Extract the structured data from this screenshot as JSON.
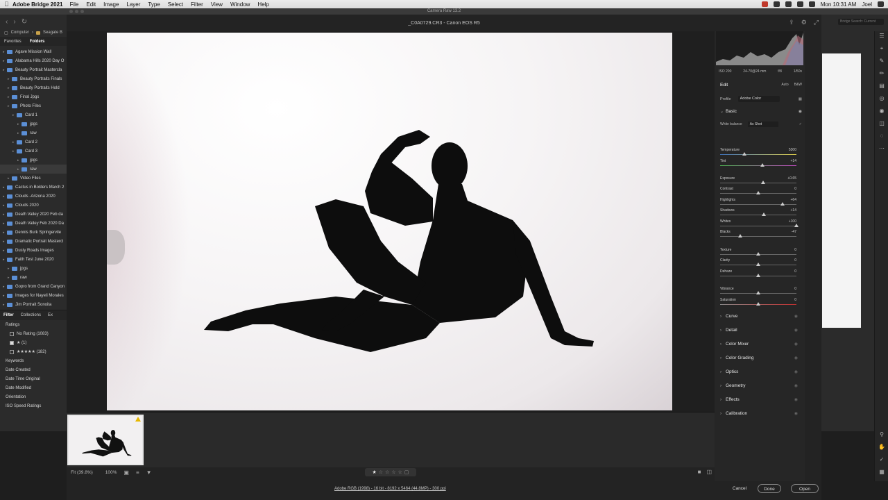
{
  "menubar": {
    "app": "Adobe Bridge 2021",
    "items": [
      "File",
      "Edit",
      "Image",
      "Layer",
      "Type",
      "Select",
      "Filter",
      "View",
      "Window",
      "Help"
    ],
    "clock": "Mon 10:31 AM",
    "user": "Joel"
  },
  "window": {
    "title": "Camera Raw 13.2"
  },
  "bridge": {
    "path": [
      "Computer",
      "Seagate B"
    ],
    "tabs": [
      "Favorites",
      "Folders"
    ],
    "folders": [
      {
        "label": "Agave Mission Wall",
        "depth": 0
      },
      {
        "label": "Alabama Hills 2020 Day O",
        "depth": 0
      },
      {
        "label": "Beauty Portrait Mastercla",
        "depth": 0
      },
      {
        "label": "Beauty Portraits Finals",
        "depth": 1
      },
      {
        "label": "Beauty Portraits Hold",
        "depth": 1
      },
      {
        "label": "Final Jpgs",
        "depth": 1
      },
      {
        "label": "Photo Files",
        "depth": 1
      },
      {
        "label": "Card 1",
        "depth": 2
      },
      {
        "label": "jpgs",
        "depth": 3
      },
      {
        "label": "raw",
        "depth": 3
      },
      {
        "label": "Card 2",
        "depth": 2
      },
      {
        "label": "Card 3",
        "depth": 2
      },
      {
        "label": "jpgs",
        "depth": 3
      },
      {
        "label": "raw",
        "depth": 3
      },
      {
        "label": "Video Files",
        "depth": 1
      },
      {
        "label": "Cactus in Bolders March 2",
        "depth": 0
      },
      {
        "label": "Clouds -Arizona 2020",
        "depth": 0
      },
      {
        "label": "Clouds 2020",
        "depth": 0
      },
      {
        "label": "Death Valley 2020 Feb da",
        "depth": 0
      },
      {
        "label": "Death Valley Feb 2020 Da",
        "depth": 0
      },
      {
        "label": "Dennis Burk Springervile",
        "depth": 0
      },
      {
        "label": "Dramatic Portrait Mastercl",
        "depth": 0
      },
      {
        "label": "Dusty Roads Images",
        "depth": 0
      },
      {
        "label": "Faith Test June 2020",
        "depth": 0
      },
      {
        "label": "jpgs",
        "depth": 1
      },
      {
        "label": "raw",
        "depth": 1
      },
      {
        "label": "Gopro from Grand Canyon",
        "depth": 0
      },
      {
        "label": "Images for Nayeli Morales",
        "depth": 0
      },
      {
        "label": "Jim Portrait Sonoita",
        "depth": 0
      }
    ],
    "filter_tabs": [
      "Filter",
      "Collections",
      "Ex"
    ],
    "filters": [
      {
        "label": "Ratings",
        "sub": false
      },
      {
        "label": "No Rating (1083)",
        "sub": true
      },
      {
        "label": "★ (1)",
        "sub": true
      },
      {
        "label": "★★★★★ (182)",
        "sub": true
      },
      {
        "label": "Keywords",
        "sub": false
      },
      {
        "label": "Date Created",
        "sub": false
      },
      {
        "label": "Date Time Original",
        "sub": false
      },
      {
        "label": "Date Modified",
        "sub": false
      },
      {
        "label": "Orientation",
        "sub": false
      },
      {
        "label": "ISO Speed Ratings",
        "sub": false
      }
    ],
    "search_placeholder": "Bridge Search: Current"
  },
  "acr": {
    "file_title": "_C0A0729.CR3  -  Canon EOS R5",
    "exif": [
      "ISO 200",
      "24-70@24 mm",
      "f/8",
      "1/50s"
    ],
    "edit_label": "Edit",
    "auto_label": "Auto",
    "bw_label": "B&W",
    "profile_label": "Profile",
    "profile_value": "Adobe Color",
    "basic_label": "Basic",
    "wb_label": "White balance",
    "wb_value": "As Shot",
    "sliders": [
      {
        "label": "Temperature",
        "value": "5300",
        "pos": 0.32
      },
      {
        "label": "Tint",
        "value": "+14",
        "pos": 0.55
      },
      {
        "label": "Exposure",
        "value": "+0.65",
        "pos": 0.56
      },
      {
        "label": "Contrast",
        "value": "0",
        "pos": 0.5
      },
      {
        "label": "Highlights",
        "value": "+64",
        "pos": 0.82
      },
      {
        "label": "Shadows",
        "value": "+14",
        "pos": 0.57
      },
      {
        "label": "Whites",
        "value": "+100",
        "pos": 1.0
      },
      {
        "label": "Blacks",
        "value": "-47",
        "pos": 0.26
      },
      {
        "label": "Texture",
        "value": "0",
        "pos": 0.5
      },
      {
        "label": "Clarity",
        "value": "0",
        "pos": 0.5
      },
      {
        "label": "Dehaze",
        "value": "0",
        "pos": 0.5
      },
      {
        "label": "Vibrance",
        "value": "0",
        "pos": 0.5
      },
      {
        "label": "Saturation",
        "value": "0",
        "pos": 0.5
      }
    ],
    "sections": [
      "Curve",
      "Detail",
      "Color Mixer",
      "Color Grading",
      "Optics",
      "Geometry",
      "Effects",
      "Calibration"
    ],
    "zoom_fit": "Fit (39.8%)",
    "zoom_100": "100%",
    "footer_meta": "Adobe RGB (1998) - 16 bit - 8192 x 5464 (44.8MP) - 300 ppi",
    "cancel": "Cancel",
    "done": "Done",
    "open": "Open"
  }
}
